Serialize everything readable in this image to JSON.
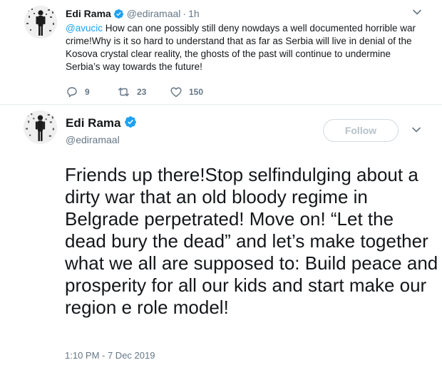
{
  "parent_tweet": {
    "author_name": "Edi Rama",
    "author_handle": "@ediramaal",
    "separator": "·",
    "time": "1h",
    "mention": "@avucic",
    "text": "How can one possibly still deny nowdays a well documented horrible war crime!Why is it so hard to understand that as far as Serbia will live in denial of the Kosova crystal clear reality, the ghosts of the past will continue to undermine Serbia’s way towards the future!",
    "replies": "9",
    "retweets": "23",
    "likes": "150"
  },
  "main_tweet": {
    "author_name": "Edi Rama",
    "author_handle": "@ediramaal",
    "follow_label": "Follow",
    "text": "Friends up there!Stop selfindulging about a dirty war that an old bloody regime in Belgrade perpetrated! Move on! “Let the dead bury the dead” and let’s make together what we all are supposed to: Build peace and prosperity for all our kids and start make our region e role model!",
    "timestamp": "1:10 PM - 7 Dec 2019"
  },
  "colors": {
    "accent": "#1da1f2",
    "muted_text": "#657786",
    "primary_text": "#14171a",
    "divider": "#e6ecf0",
    "follow_border": "#d3dae0"
  },
  "icons": [
    "avatar-photo",
    "verified-badge-icon",
    "chevron-down-icon",
    "reply-icon",
    "retweet-icon",
    "like-heart-icon"
  ]
}
